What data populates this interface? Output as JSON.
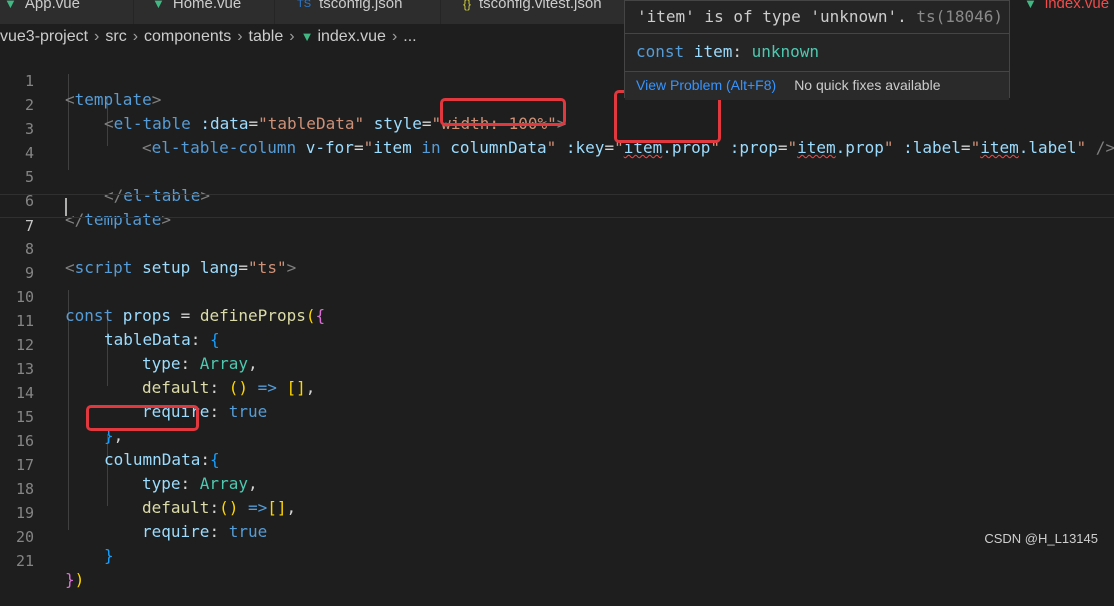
{
  "tabs": [
    {
      "label": "App.vue",
      "icon": "vue-icon",
      "mark": "▼",
      "active": false
    },
    {
      "label": "Home.vue",
      "icon": "vue-icon",
      "mark": "▼",
      "active": false
    },
    {
      "label": "tsconfig.json",
      "icon": "ts-icon",
      "mark": "TS",
      "active": false
    },
    {
      "label": "tsconfig.vitest.json",
      "icon": "json-icon",
      "mark": "{}",
      "active": false
    },
    {
      "label": "index.vue",
      "icon": "vue-icon",
      "mark": "▼",
      "active": true
    }
  ],
  "breadcrumb": [
    "vue3-project",
    "src",
    "components",
    "table",
    "index.vue",
    "..."
  ],
  "line_numbers": [
    "1",
    "2",
    "3",
    "4",
    "5",
    "6",
    "7",
    "8",
    "9",
    "10",
    "11",
    "12",
    "13",
    "14",
    "15",
    "16",
    "17",
    "18",
    "19",
    "20",
    "21"
  ],
  "code": {
    "l1_open": "<",
    "l1_tag": "template",
    "l1_close": ">",
    "l2_open": "<",
    "l2_tag": "el-table",
    "l2_attr1": " :data",
    "l2_eq1": "=",
    "l2_val1": "\"tableData\"",
    "l2_attr2": " style",
    "l2_eq2": "=",
    "l2_val2": "\"width: 100%\"",
    "l2_close": ">",
    "l3_open": "<",
    "l3_tag": "el-table-column",
    "l3_attr1": " v-for",
    "l3_eq1": "=",
    "l3_q1": "\"",
    "l3_item": "item",
    "l3_in": " in",
    "l3_sp": " ",
    "l3_coldata": "columnData",
    "l3_q2": "\"",
    "l3_attr2": " :key",
    "l3_eq2": "=",
    "l3_q3": "\"",
    "l3_item2": "item",
    "l3_dot1": ".prop",
    "l3_q4": "\"",
    "l3_attr3": " :prop",
    "l3_eq3": "=",
    "l3_q5": "\"",
    "l3_item3": "item",
    "l3_dot2": ".prop",
    "l3_q6": "\"",
    "l3_attr4": " :label",
    "l3_eq4": "=",
    "l3_q7": "\"",
    "l3_item4": "item",
    "l3_dot3": ".label",
    "l3_q8": "\"",
    "l3_end": " />",
    "l5_open": "</",
    "l5_tag": "el-table",
    "l5_close": ">",
    "l6_open": "</",
    "l6_tag": "template",
    "l6_close": ">",
    "l8_open": "<",
    "l8_tag": "script",
    "l8_attr1": " setup",
    "l8_attr2": " lang",
    "l8_eq": "=",
    "l8_val": "\"ts\"",
    "l8_close": ">",
    "l10_const": "const",
    "l10_props": " props",
    "l10_eq": " = ",
    "l10_fn": "defineProps",
    "l10_paren": "(",
    "l10_brace": "{",
    "l11_key": "tableData",
    "l11_colon": ": ",
    "l11_brace": "{",
    "l12_key": "type",
    "l12_colon": ": ",
    "l12_val": "Array",
    "l12_comma": ",",
    "l13_key": "default",
    "l13_colon": ": ",
    "l13_paren": "()",
    "l13_arrow": " => ",
    "l13_arr": "[]",
    "l13_comma": ",",
    "l14_key": "require",
    "l14_colon": ": ",
    "l14_val": "true",
    "l15_brace": "}",
    "l15_comma": ",",
    "l16_key": "columnData",
    "l16_colon": ":",
    "l16_brace": "{",
    "l17_key": "type",
    "l17_colon": ": ",
    "l17_val": "Array",
    "l17_comma": ",",
    "l18_key": "default",
    "l18_colon": ":",
    "l18_paren": "()",
    "l18_arrow": " =>",
    "l18_arr": "[]",
    "l18_comma": ",",
    "l19_key": "require",
    "l19_colon": ": ",
    "l19_val": "true",
    "l20_brace": "}",
    "l21_brace": "}",
    "l21_paren": ")"
  },
  "hover": {
    "message": "'item' is of type 'unknown'.",
    "code": " ts(18046)",
    "sig_const": "const",
    "sig_name": " item",
    "sig_colon": ":",
    "sig_type": " unknown",
    "view_problem": "View Problem (Alt+F8)",
    "no_fixes": "No quick fixes available"
  },
  "watermark": "CSDN @H_L13145",
  "colors": {
    "error_box": "#e0383e",
    "link": "#3794ff",
    "vue": "#41b883"
  }
}
